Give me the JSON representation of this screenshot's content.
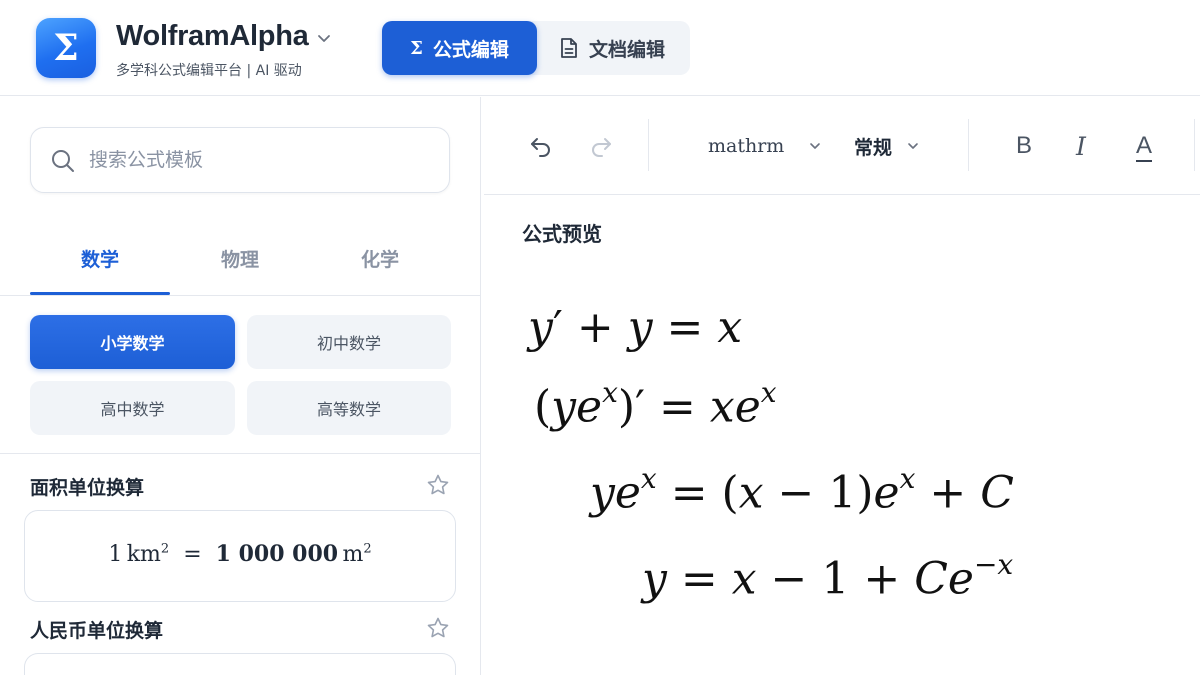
{
  "app": {
    "name": "WolframAlpha",
    "subtitle": "多学科公式编辑平台 | AI 驱动",
    "logo_glyph": "Σ"
  },
  "mode_switch": {
    "formula_label": "公式编辑",
    "document_label": "文档编辑",
    "formula_icon": "Σ",
    "active": "formula"
  },
  "search": {
    "placeholder": "搜索公式模板",
    "value": ""
  },
  "subject_tabs": {
    "items": [
      "数学",
      "物理",
      "化学"
    ],
    "active": 0
  },
  "categories": {
    "items": [
      "小学数学",
      "初中数学",
      "高中数学",
      "高等数学"
    ],
    "active": 0
  },
  "templates": [
    {
      "title": "面积单位换算",
      "formula": {
        "lhs_number": "1",
        "lhs_unit": "km",
        "lhs_exp": "2",
        "rhs_number": "1 000 000",
        "rhs_unit": "m",
        "rhs_exp": "2"
      }
    },
    {
      "title": "人民币单位换算"
    }
  ],
  "toolbar": {
    "font": "mathrm",
    "style": "常规",
    "bold_label": "B",
    "italic_label": "I",
    "color_label": "A"
  },
  "preview": {
    "label": "公式预览",
    "lines": [
      "y′ + y = x",
      "(ye^x)′ = xe^x",
      "ye^x = (x − 1)e^x + C",
      "y = x − 1 + Ce^−x"
    ]
  },
  "colors": {
    "accent": "#1d5fd6",
    "logo_gradient_start": "#4da3ff",
    "logo_gradient_end": "#1a5fe0"
  }
}
